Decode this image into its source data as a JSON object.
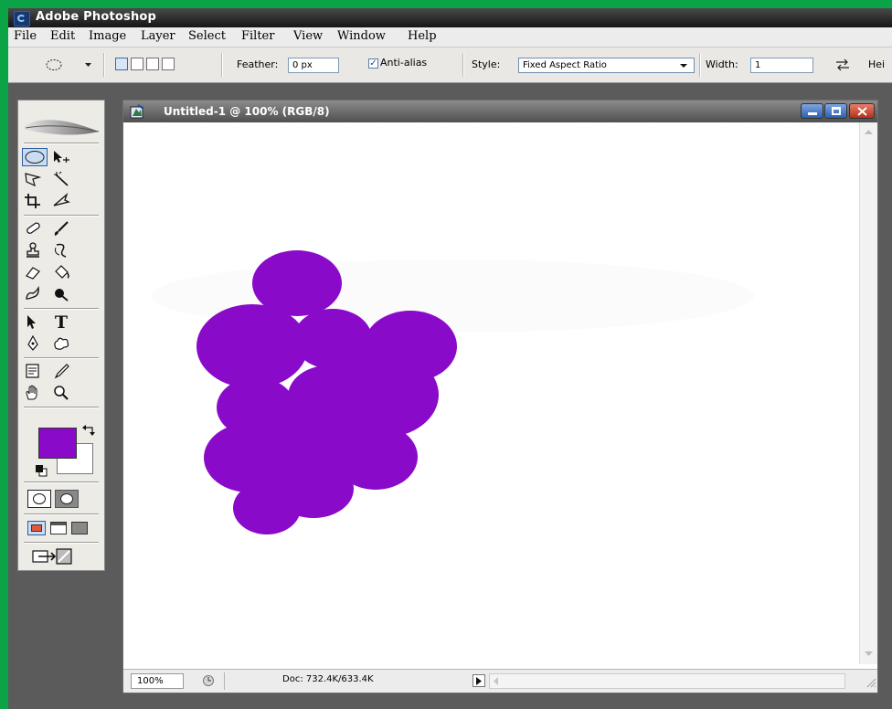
{
  "app": {
    "title": "Adobe Photoshop",
    "frame_color": "#0aa346"
  },
  "menu": {
    "items": [
      "File",
      "Edit",
      "Image",
      "Layer",
      "Select",
      "Filter",
      "View",
      "Window",
      "Help"
    ]
  },
  "options": {
    "tool_icon": "elliptical-marquee-icon",
    "feather_label": "Feather:",
    "feather_value": "0 px",
    "antialias_label": "Anti-alias",
    "antialias_checked": true,
    "style_label": "Style:",
    "style_value": "Fixed Aspect Ratio",
    "width_label": "Width:",
    "width_value": "1",
    "height_label": "Hei"
  },
  "toolbox": {
    "tools": [
      "elliptical-marquee-icon",
      "move-icon",
      "polygonal-lasso-icon",
      "magic-wand-icon",
      "crop-icon",
      "slice-icon",
      "healing-brush-icon",
      "brush-icon",
      "clone-stamp-icon",
      "history-brush-icon",
      "eraser-icon",
      "paint-bucket-icon",
      "blur-icon",
      "burn-icon",
      "path-selection-icon",
      "type-icon",
      "pen-icon",
      "custom-shape-icon",
      "notes-icon",
      "eyedropper-icon",
      "hand-icon",
      "zoom-icon"
    ],
    "type_glyph": "T",
    "foreground_color": "#8a0ac9",
    "background_color": "#ffffff"
  },
  "document": {
    "title": "Untitled-1 @ 100% (RGB/8)",
    "zoom": "100%",
    "doc_info": "Doc: 732.4K/633.4K",
    "shape_color": "#8a0ac9"
  }
}
